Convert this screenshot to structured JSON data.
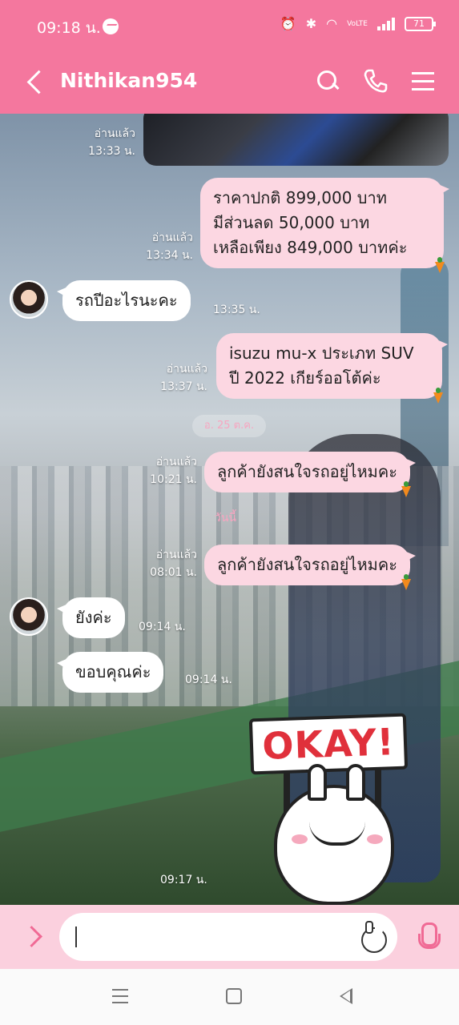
{
  "status_bar": {
    "time": "09:18 น.",
    "battery": "71",
    "network": "VoLTE"
  },
  "header": {
    "title": "Nithikan954"
  },
  "chat": {
    "image_message": {
      "read": "อ่านแล้ว",
      "time": "13:33 น."
    },
    "msg_price": {
      "lines": [
        "ราคาปกติ 899,000 บาท",
        "มีส่วนลด 50,000 บาท",
        "เหลือเพียง 849,000 บาทค่ะ"
      ],
      "read": "อ่านแล้ว",
      "time": "13:34 น."
    },
    "msg_year_q": {
      "text": "รถปีอะไรนะคะ",
      "time": "13:35 น."
    },
    "msg_model": {
      "lines": [
        "isuzu mu-x ประเภท SUV",
        "ปี 2022 เกียร์ออโต้ค่ะ"
      ],
      "read": "อ่านแล้ว",
      "time": "13:37 น."
    },
    "date_divider": "อ. 25 ต.ค.",
    "msg_followup1": {
      "text": "ลูกค้ายังสนใจรถอยู่ไหมคะ",
      "read": "อ่านแล้ว",
      "time": "10:21 น."
    },
    "day_divider": "วันนี้",
    "msg_followup2": {
      "text": "ลูกค้ายังสนใจรถอยู่ไหมคะ",
      "read": "อ่านแล้ว",
      "time": "08:01 น."
    },
    "msg_yes": {
      "text": "ยังค่ะ",
      "time": "09:14 น."
    },
    "msg_thanks": {
      "text": "ขอบคุณค่ะ",
      "time": "09:14 น."
    },
    "sticker": {
      "text": "OKAY!",
      "time": "09:17 น."
    }
  },
  "input": {
    "placeholder": ""
  },
  "colors": {
    "brand": "#f4779e",
    "outgoing_bubble": "#fcd7e2",
    "incoming_bubble": "#ffffff",
    "input_bar": "#fbd0de"
  }
}
